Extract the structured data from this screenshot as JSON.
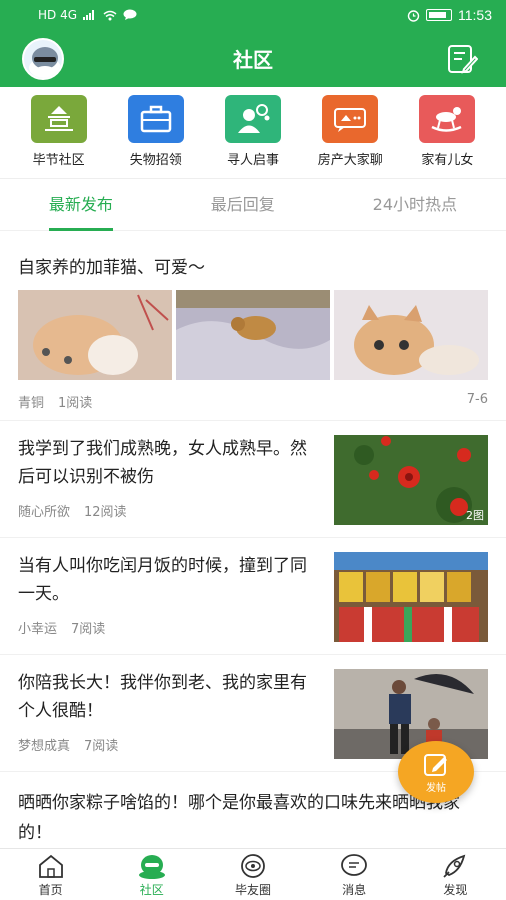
{
  "status_bar": {
    "network": "HD 4G",
    "time": "11:53"
  },
  "header": {
    "title": "社区"
  },
  "categories": [
    {
      "label": "毕节社区",
      "icon": "community-icon",
      "color": "#7aa83b"
    },
    {
      "label": "失物招领",
      "icon": "briefcase-icon",
      "color": "#2f7ee0"
    },
    {
      "label": "寻人启事",
      "icon": "person-search-icon",
      "color": "#2fb57a"
    },
    {
      "label": "房产大家聊",
      "icon": "house-chat-icon",
      "color": "#e9682d"
    },
    {
      "label": "家有儿女",
      "icon": "rocking-horse-icon",
      "color": "#e85a5a"
    }
  ],
  "tabs": [
    {
      "label": "最新发布",
      "active": true
    },
    {
      "label": "最后回复",
      "active": false
    },
    {
      "label": "24小时热点",
      "active": false
    }
  ],
  "posts": [
    {
      "title": "自家养的加菲猫、可爱～",
      "author": "青铜",
      "reads": "1阅读",
      "date": "7-6",
      "images": [
        "cat-photo-1",
        "cat-photo-2",
        "cat-photo-3"
      ]
    },
    {
      "title": "我学到了我们成熟晚，女人成熟早。然后可以识别不被伤",
      "author": "随心所欲",
      "reads": "12阅读",
      "badge": "2图",
      "image": "red-flowers-photo"
    },
    {
      "title": "当有人叫你吃闰月饭的时候，撞到了同一天。",
      "author": "小幸运",
      "reads": "7阅读",
      "image": "market-shelves-photo"
    },
    {
      "title": "你陪我长大！我伴你到老、我的家里有个人很酷！",
      "author": "梦想成真",
      "reads": "7阅读",
      "image": "father-child-umbrella-photo"
    },
    {
      "title": "晒晒你家粽子啥馅的！哪个是你最喜欢的口味先来晒晒我家的！"
    }
  ],
  "fab": {
    "label": "发帖"
  },
  "bottom_nav": [
    {
      "label": "首页",
      "icon": "home-icon",
      "active": false
    },
    {
      "label": "社区",
      "icon": "community-mascot-icon",
      "active": true
    },
    {
      "label": "毕友圈",
      "icon": "eye-circle-icon",
      "active": false
    },
    {
      "label": "消息",
      "icon": "message-icon",
      "active": false
    },
    {
      "label": "发现",
      "icon": "rocket-icon",
      "active": false
    }
  ],
  "colors": {
    "primary": "#27ad52",
    "fab": "#f5a623"
  }
}
